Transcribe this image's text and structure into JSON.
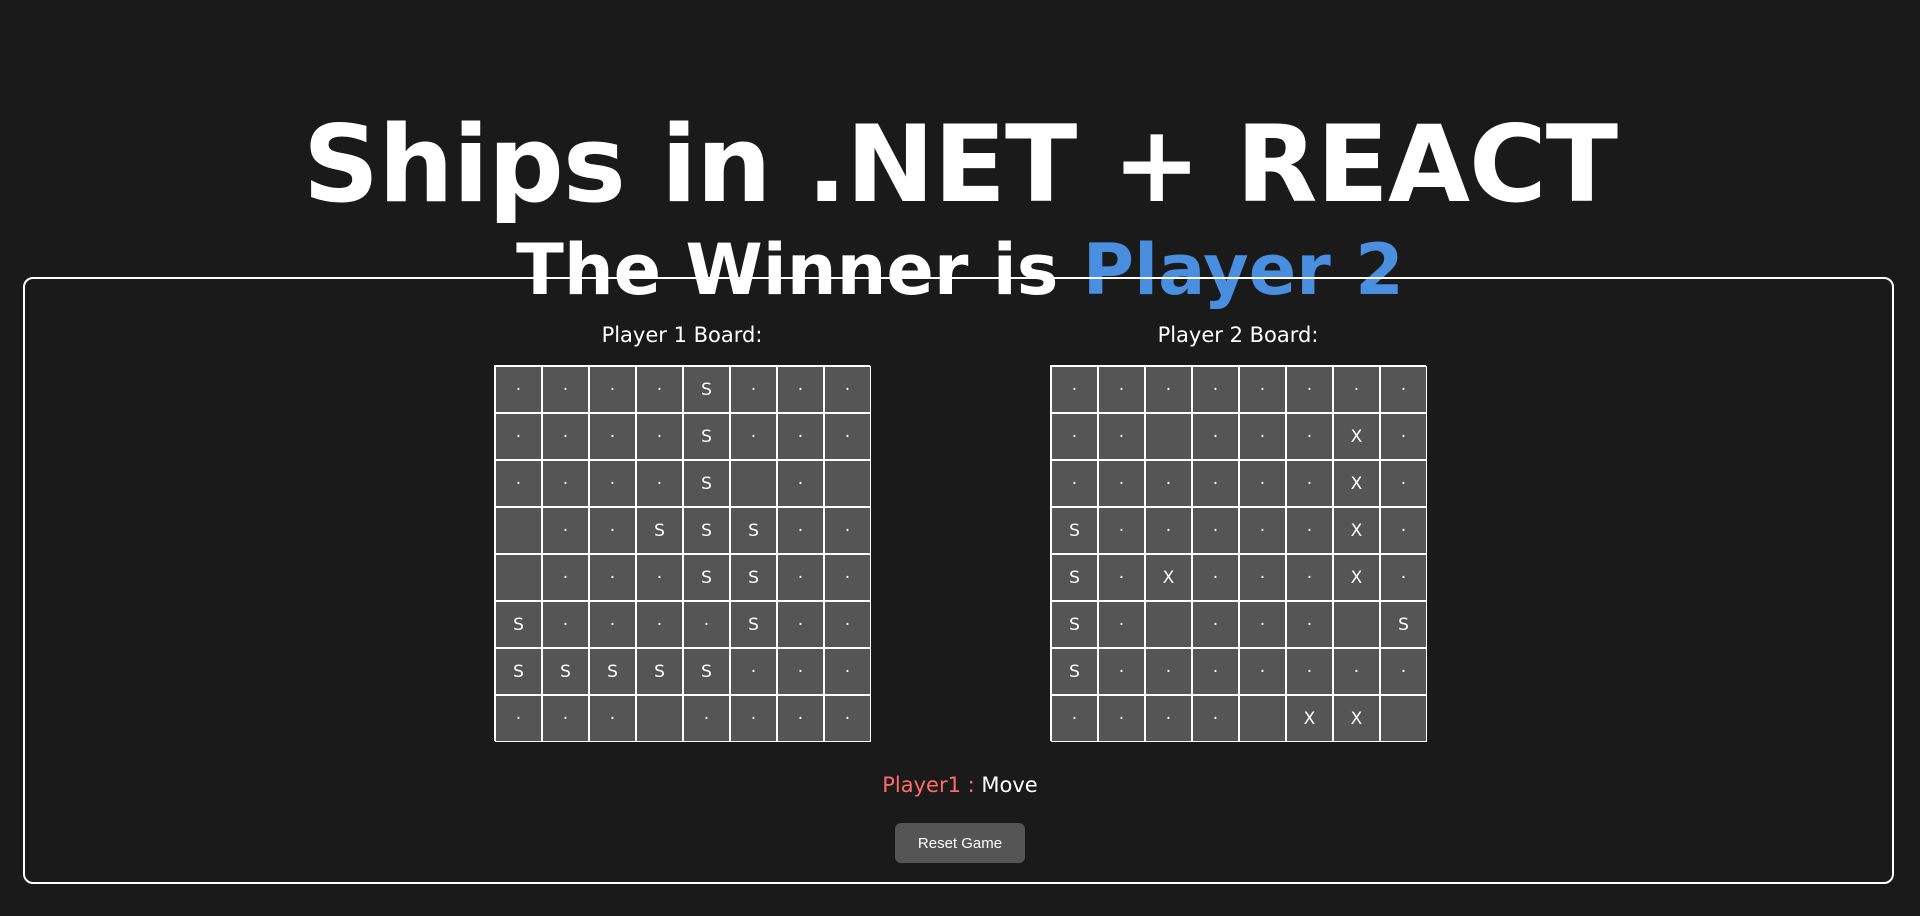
{
  "header": {
    "title": "Ships in .NET + REACT",
    "winner_prefix": "The Winner is ",
    "winner_name": "Player 2",
    "winner_color": "#4a8ee0"
  },
  "boards": [
    {
      "label": "Player 1 Board:",
      "cells": [
        [
          "·",
          "·",
          "·",
          "·",
          "S",
          "·",
          "·",
          "·"
        ],
        [
          "·",
          "·",
          "·",
          "·",
          "S",
          "·",
          "·",
          "·"
        ],
        [
          "·",
          "·",
          "·",
          "·",
          "S",
          "",
          "·",
          ""
        ],
        [
          "",
          "·",
          "·",
          "S",
          "S",
          "S",
          "·",
          "·"
        ],
        [
          "",
          "·",
          "·",
          "·",
          "S",
          "S",
          "·",
          "·"
        ],
        [
          "S",
          "·",
          "·",
          "·",
          "·",
          "S",
          "·",
          "·"
        ],
        [
          "S",
          "S",
          "S",
          "S",
          "S",
          "·",
          "·",
          "·"
        ],
        [
          "·",
          "·",
          "·",
          "",
          "·",
          "·",
          "·",
          "·"
        ]
      ]
    },
    {
      "label": "Player 2 Board:",
      "cells": [
        [
          "·",
          "·",
          "·",
          "·",
          "·",
          "·",
          "·",
          "·"
        ],
        [
          "·",
          "·",
          "",
          "·",
          "·",
          "·",
          "X",
          "·"
        ],
        [
          "·",
          "·",
          "·",
          "·",
          "·",
          "·",
          "X",
          "·"
        ],
        [
          "S",
          "·",
          "·",
          "·",
          "·",
          "·",
          "X",
          "·"
        ],
        [
          "S",
          "·",
          "X",
          "·",
          "·",
          "·",
          "X",
          "·"
        ],
        [
          "S",
          "·",
          "",
          "·",
          "·",
          "·",
          "",
          "S"
        ],
        [
          "S",
          "·",
          "·",
          "·",
          "·",
          "·",
          "·",
          "·"
        ],
        [
          "·",
          "·",
          "·",
          "·",
          "",
          "X",
          "X",
          ""
        ]
      ]
    }
  ],
  "status": {
    "player": "Player1 :",
    "player_color": "#ff6b6b",
    "action": "Move"
  },
  "controls": {
    "reset_label": "Reset Game"
  }
}
